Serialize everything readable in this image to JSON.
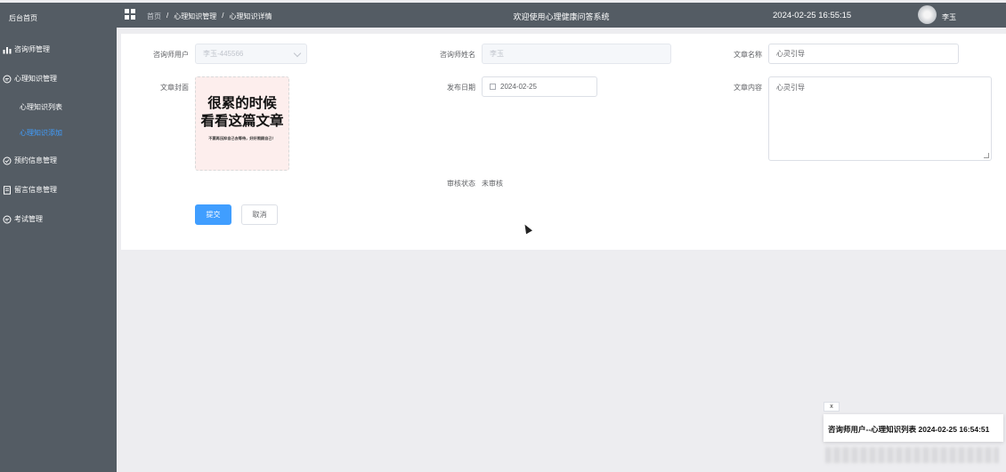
{
  "sidebar": {
    "home": "后台首页",
    "items": [
      {
        "label": "咨询师管理",
        "icon": "bar-chart-icon"
      },
      {
        "label": "心理知识管理",
        "icon": "chat-icon"
      },
      {
        "label": "预约信息管理",
        "icon": "check-circle-icon"
      },
      {
        "label": "留言信息管理",
        "icon": "document-icon"
      },
      {
        "label": "考试管理",
        "icon": "chat-icon"
      }
    ],
    "subitems": [
      {
        "label": "心理知识列表"
      },
      {
        "label": "心理知识添加",
        "active": true
      }
    ]
  },
  "header": {
    "breadcrumb": [
      "首页",
      "/",
      "心理知识管理",
      "/",
      "心理知识详情"
    ],
    "title": "欢迎使用心理健康问答系统",
    "datetime": "2024-02-25 16:55:15",
    "username": "李玉"
  },
  "form": {
    "counselor_user_label": "咨询师用户",
    "counselor_user_value": "李玉-445566",
    "counselor_name_label": "咨询师姓名",
    "counselor_name_value": "李玉",
    "article_name_label": "文章名称",
    "article_name_value": "心灵引导",
    "cover_label": "文章封面",
    "cover_text": {
      "line1": "很累的时候",
      "line2": "看看这篇文章",
      "line3": "不要再压抑自己去等待，好好照顾自己！"
    },
    "publish_date_label": "发布日期",
    "publish_date_value": "2024-02-25",
    "content_label": "文章内容",
    "content_value": "心灵引导",
    "audit_status_label": "审核状态",
    "audit_status_value": "未审核",
    "submit_label": "提交",
    "cancel_label": "取消"
  },
  "notification": {
    "close_label": "x",
    "message": "咨询师用户--心理知识列表 2024-02-25 16:54:51"
  },
  "colors": {
    "sidebar_bg": "#545c64",
    "active": "#409eff",
    "primary_button": "#409eff"
  }
}
